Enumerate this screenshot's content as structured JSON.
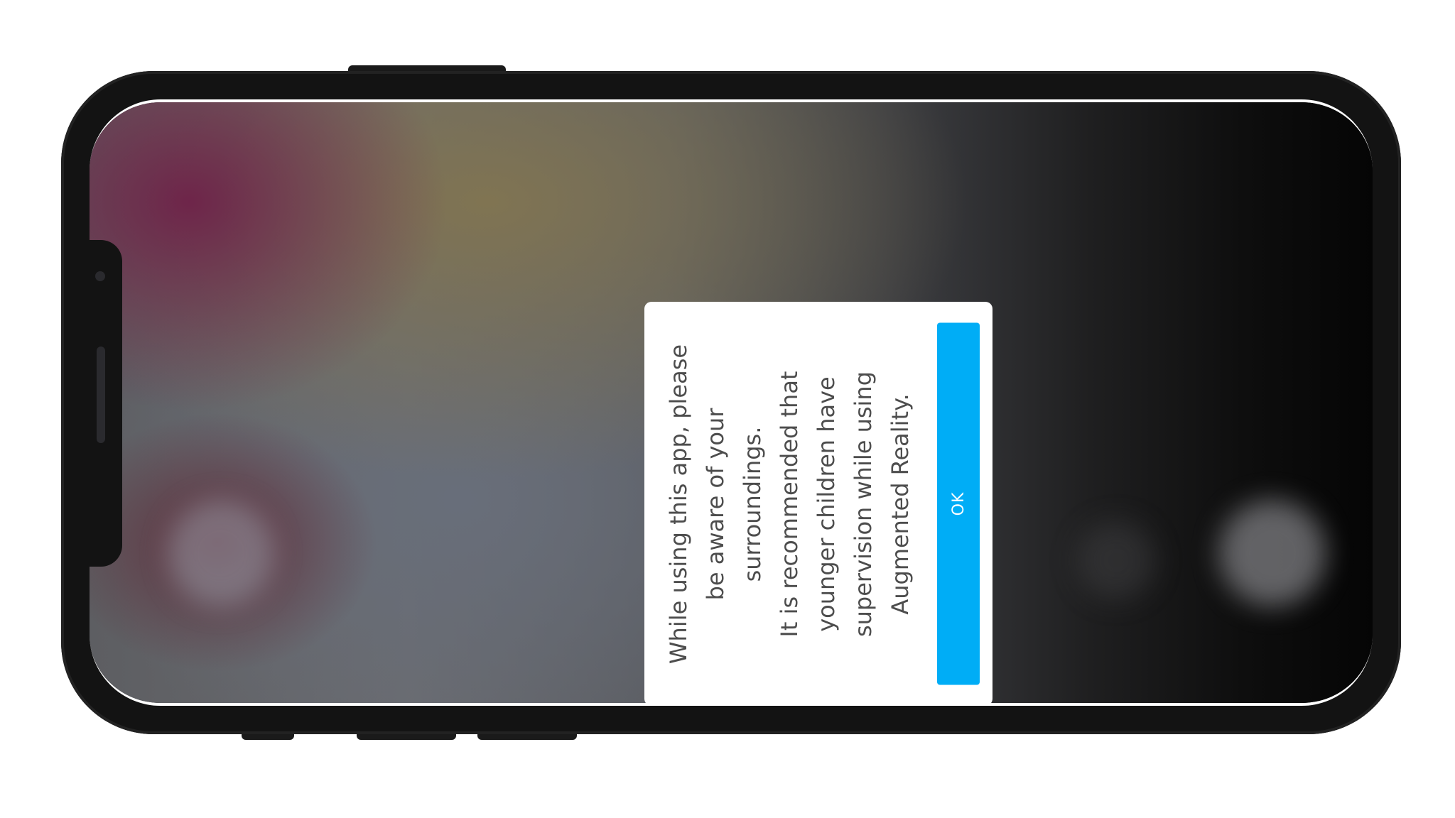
{
  "dialog": {
    "message_lines": [
      "While using this app, please",
      "be aware of your",
      "surroundings.",
      "It is recommended that",
      "younger children have",
      "supervision while using",
      "Augmented Reality."
    ],
    "ok_label": "OK",
    "button_color": "#00adf6"
  },
  "device": {
    "frame_color": "#131313",
    "orientation": "landscape"
  }
}
